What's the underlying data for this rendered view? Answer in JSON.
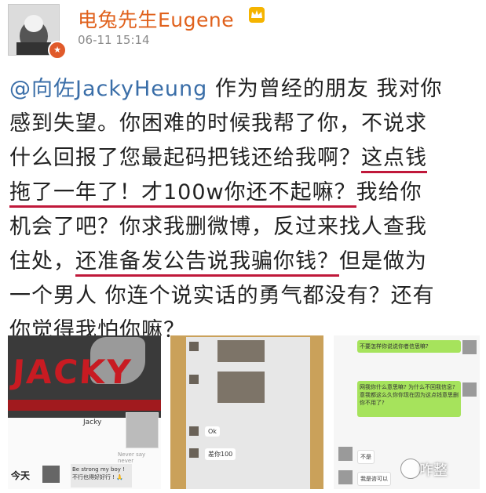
{
  "post": {
    "username": "电兔先生Eugene",
    "timestamp": "06-11 15:14",
    "mention": "@向佐JackyHeung",
    "line1_rest": " 作为曾经的朋友 我对你",
    "line2": "感到失望。你困难的时候我帮了你，不说求",
    "line3_a": "什么回报了您最起码把钱还给我啊？",
    "line3_hl": "这点钱",
    "line4_hl": "拖了一年了！才100w你还不起嘛？",
    "line4_rest": "我给你",
    "line5": "机会了吧？你求我删微博，反过来找人查我",
    "line6_a": "住处，",
    "line6_hl": "还准备发公告说我骗你钱？",
    "line6_rest": "但是做为",
    "line7": "一个男人 你连个说实话的勇气都没有？还有",
    "line8": "你觉得我怕你嘛？"
  },
  "images": {
    "p1": {
      "banner": "JACKY",
      "name": "Jacky",
      "faint": "Never say never",
      "today": "今天",
      "bubble": "Be strong my boy ! 不行也得好好行 ! 🙏"
    },
    "p2": {
      "msg1": "Ok",
      "msg2": "差你100"
    },
    "p3": {
      "msg1": "不要怎样你说说你者信思嘛?",
      "msg2": "网我你什么意思嘛? 为什么不回我信息? 意我都这么久你你现在因为这点钱意思删你不用了?",
      "msg3": "不是",
      "msg4": "我是咨可以"
    }
  },
  "watermark": "咋整",
  "colors": {
    "username": "#e0611c",
    "mention": "#3a6ea8",
    "highlight": "#c0183a"
  }
}
